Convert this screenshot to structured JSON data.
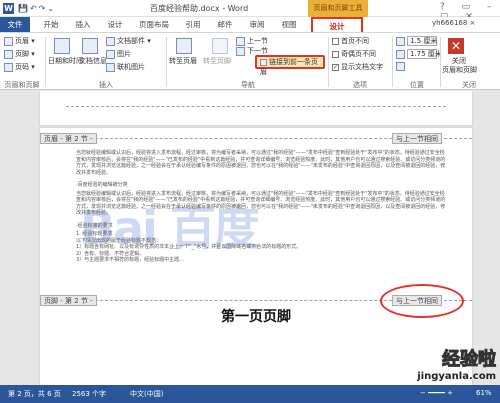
{
  "titlebar": {
    "app_icon": "W",
    "title": "百度经验帮助.docx - Word",
    "tool_title": "页眉和页脚工具",
    "window_controls": "? ▭ – ▢ ✕"
  },
  "tabs": {
    "file": "文件",
    "items": [
      "开始",
      "插入",
      "设计",
      "页面布局",
      "引用",
      "邮件",
      "审阅",
      "视图"
    ],
    "design": "设计",
    "user": "yh666168 ×"
  },
  "ribbon": {
    "header": "页眉",
    "footer": "页脚",
    "page_number": "页码",
    "header_footer_group": "页眉和页脚",
    "date_time": "日期和时间",
    "doc_info": "文档信息",
    "doc_parts": "文档部件",
    "picture": "图片",
    "online_picture": "联机图片",
    "insert_group": "插入",
    "goto_header": "转至页眉",
    "goto_footer": "转至页脚",
    "prev_section": "上一节",
    "next_section": "下一节",
    "link_prev": "链接到前一条页眉",
    "nav_group": "导航",
    "diff_first": "首页不同",
    "diff_odd_even": "奇偶页不同",
    "show_doc_text": "显示文档文字",
    "options_group": "选项",
    "header_pos": "1.5 厘米",
    "footer_pos": "1.75 厘米",
    "position_group": "位置",
    "close_label": "关闭\n页眉和页脚",
    "close_label_1": "关闭",
    "close_label_2": "页眉和页脚",
    "close_group": "关闭"
  },
  "document": {
    "header_tag": "页眉 - 第 2 节 -",
    "same_as_prev_1": "与上一节相同",
    "para1": "当您就经验编辑或认识后，经验将进入发布流程，经过审核，将为编写者采纳，可以通过\"我的经验\"——\"发布中经验\"查到经验处于\"发布中\"的状态。待经验通过安全检查和内容审核后，会将在\"我的经验\"——\"已发布的经验\"中看到这篇经验，并可查询详细编号、浏览经验热度、此时，其他用户也可以通过搜索经验、或访问分类频道的方式，发现并浏览这篇经验。之一经验会在于承认经验编写条件的原因被退回，您也可以在\"我的经验\"——\"未发布的经验\"中查询退回原因，以及查阅被退回的经验，修改并发布经验。",
    "heading1": "·百度经验的编辑被分类",
    "para2": "当您就经验编辑或认识后，经验将进入发布流程，经过审核，将为编写者采纳，可以通过\"我的经验\"——\"发布中经验\"查到经验处于\"发布中\"的状态。待经验通过安全检查和内容审核后，会将在\"我的经验\"——\"已发布的经验\"中看到这篇经验，并可查询详细编号、浏览经验热度、此时，其他用户也可以通过搜索经验、或访问分类频道的方式，发现并浏览这篇经验。之一经验会在于承认经验编写条件的原因被退回，您也可以在\"我的经验\"——\"未发布的经验\"中查询退回原因，以及查阅被退回的经验，修改并发布经验。",
    "heading2": "·经验标准的要求",
    "list_title": "1. 经验标题要求",
    "list_intro": "以下情况出现的属于经验标题不规范：",
    "list_1": "1）标题含有网址、以及有诱导性质的非本业上一个\"_\"水号，并且以国际域名或不合法的标题的形式。",
    "list_2": "2）含有、标题、不符合逻辑。",
    "list_3": "3）与主题要求不相符的标题，经验标题中主题...",
    "watermark": "Bai 百度",
    "footer_tag": "页脚 - 第 2 节 -",
    "same_as_prev_2": "与上一节相同",
    "footer_text": "第一页页脚"
  },
  "statusbar": {
    "page": "第 2 页，共 6 页",
    "words": "2563 个字",
    "lang": "中文(中国)",
    "zoom": "61%"
  },
  "watermark_site": {
    "name": "经验啦",
    "url": "jingyanla.com"
  },
  "colors": {
    "brand": "#2b579a",
    "highlight_red": "#e0342a",
    "tool_tab": "#e9b13a"
  }
}
